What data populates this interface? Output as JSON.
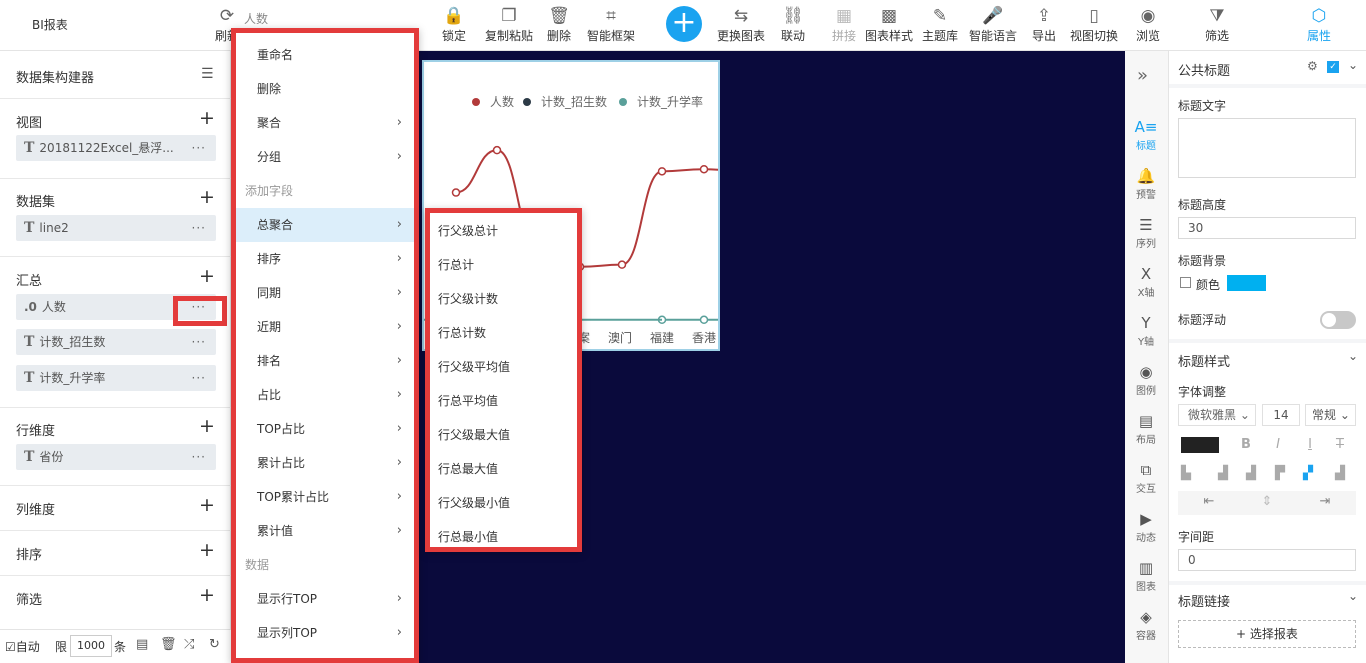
{
  "app": {
    "title": "BI报表"
  },
  "toolbar": {
    "refresh_label": "刷新",
    "field_dropdown": "人数",
    "items": [
      {
        "label": "锁定",
        "icon": "lock-icon"
      },
      {
        "label": "复制粘贴",
        "icon": "copy-icon"
      },
      {
        "label": "删除",
        "icon": "trash-icon"
      },
      {
        "label": "智能框架",
        "icon": "frame-icon"
      },
      {
        "label": "更换图表",
        "icon": "chart-swap-icon"
      },
      {
        "label": "联动",
        "icon": "link-icon"
      },
      {
        "label": "拼接",
        "icon": "grid-icon"
      },
      {
        "label": "图表样式",
        "icon": "style-icon"
      },
      {
        "label": "主题库",
        "icon": "brush-icon"
      },
      {
        "label": "智能语言",
        "icon": "mic-icon"
      },
      {
        "label": "导出",
        "icon": "export-icon"
      },
      {
        "label": "视图切换",
        "icon": "phone-icon"
      },
      {
        "label": "浏览",
        "icon": "eye-icon"
      },
      {
        "label": "筛选",
        "icon": "filter-icon"
      },
      {
        "label": "属性",
        "icon": "hexagon-icon"
      }
    ],
    "add_symbol": "+"
  },
  "left": {
    "title": "数据集构建器",
    "sections": {
      "view": {
        "title": "视图",
        "fields": [
          "20181122Excel_悬浮..."
        ]
      },
      "dataset": {
        "title": "数据集",
        "fields": [
          "line2"
        ]
      },
      "summary": {
        "title": "汇总",
        "fields": [
          "人数",
          "计数_招生数",
          "计数_升学率"
        ]
      },
      "row_dim": {
        "title": "行维度",
        "fields": [
          "省份"
        ]
      },
      "col_dim": {
        "title": "列维度"
      },
      "sort": {
        "title": "排序"
      },
      "filter": {
        "title": "筛选"
      }
    },
    "dots": "···",
    "numeric_prefix": ".0",
    "text_prefix": "T",
    "plus": "+",
    "bottom": {
      "auto": "自动",
      "limit": "限",
      "limit_value": "1000",
      "unit": "条"
    }
  },
  "chart_data": {
    "type": "line",
    "legend": [
      "人数",
      "计数_招生数",
      "计数_升学率"
    ],
    "categories": [
      "澳门",
      "福建",
      "香港"
    ],
    "series": [
      {
        "name": "人数",
        "color": "#b23a3a",
        "values": [
          null,
          0.62,
          0.82,
          0.35,
          0.27,
          0.28,
          0.72,
          0.73,
          0.72
        ]
      },
      {
        "name": "计数_升学率",
        "color": "#5aa09a",
        "values": [
          null,
          null,
          null,
          null,
          null,
          null,
          0.02,
          0.02,
          0.02
        ]
      }
    ],
    "partial_tick": "案",
    "legend_position": "top-right"
  },
  "context_menu": {
    "items": [
      {
        "label": "重命名",
        "type": "item"
      },
      {
        "label": "删除",
        "type": "item"
      },
      {
        "label": "聚合",
        "type": "sub"
      },
      {
        "label": "分组",
        "type": "sub"
      },
      {
        "label": "添加字段",
        "type": "header"
      },
      {
        "label": "总聚合",
        "type": "sub",
        "active": true
      },
      {
        "label": "排序",
        "type": "sub"
      },
      {
        "label": "同期",
        "type": "sub"
      },
      {
        "label": "近期",
        "type": "sub"
      },
      {
        "label": "排名",
        "type": "sub"
      },
      {
        "label": "占比",
        "type": "sub"
      },
      {
        "label": "TOP占比",
        "type": "sub"
      },
      {
        "label": "累计占比",
        "type": "sub"
      },
      {
        "label": "TOP累计占比",
        "type": "sub"
      },
      {
        "label": "累计值",
        "type": "sub"
      },
      {
        "label": "数据",
        "type": "header"
      },
      {
        "label": "显示行TOP",
        "type": "sub"
      },
      {
        "label": "显示列TOP",
        "type": "sub"
      }
    ],
    "arrow": "›"
  },
  "submenu": {
    "items": [
      "行父级总计",
      "行总计",
      "行父级计数",
      "行总计数",
      "行父级平均值",
      "行总平均值",
      "行父级最大值",
      "行总最大值",
      "行父级最小值",
      "行总最小值"
    ]
  },
  "icon_strip": {
    "collapse": "»",
    "items": [
      {
        "label": "标题",
        "icon": "title-icon",
        "selected": true
      },
      {
        "label": "预警",
        "icon": "bell-icon"
      },
      {
        "label": "序列",
        "icon": "list-icon"
      },
      {
        "label": "X轴",
        "icon": "x-axis-icon"
      },
      {
        "label": "Y轴",
        "icon": "y-axis-icon"
      },
      {
        "label": "图例",
        "icon": "legend-icon"
      },
      {
        "label": "布局",
        "icon": "layout-icon"
      },
      {
        "label": "交互",
        "icon": "interact-icon"
      },
      {
        "label": "动态",
        "icon": "dynamic-icon"
      },
      {
        "label": "图表",
        "icon": "chart-icon"
      },
      {
        "label": "容器",
        "icon": "layers-icon"
      }
    ]
  },
  "props": {
    "header": "公共标题",
    "title_text_label": "标题文字",
    "title_text_value": "",
    "title_height_label": "标题高度",
    "title_height_value": "30",
    "title_bg_label": "标题背景",
    "color_label": "颜色",
    "color_value": "#00b0f0",
    "title_float_label": "标题浮动",
    "style_header": "标题样式",
    "font_adjust_label": "字体调整",
    "font_family": "微软雅黑",
    "font_size": "14",
    "font_weight": "常规",
    "text_color": "#222222",
    "letter_spacing_label": "字间距",
    "letter_spacing_value": "0",
    "link_header": "标题链接",
    "select_report": "选择报表"
  }
}
